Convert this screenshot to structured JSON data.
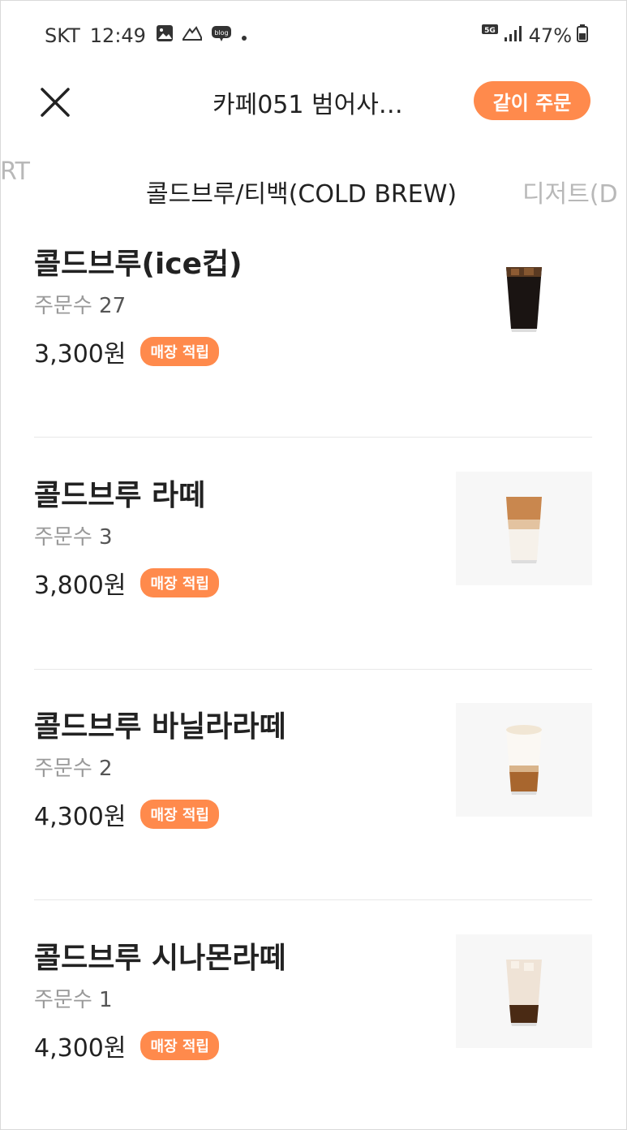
{
  "status_bar": {
    "carrier": "SKT",
    "time": "12:49",
    "battery": "47%"
  },
  "header": {
    "title": "카페051 범어사…",
    "group_order_label": "같이 주문"
  },
  "tabs": {
    "prev": "RT",
    "active": "콜드브루/티백(COLD BREW)",
    "next": "디저트(D"
  },
  "orders_label": "주문수",
  "items": [
    {
      "name": "콜드브루(ice컵)",
      "order_count": "27",
      "price": "3,300원",
      "badge": "매장 적립"
    },
    {
      "name": "콜드브루 라떼",
      "order_count": "3",
      "price": "3,800원",
      "badge": "매장 적립"
    },
    {
      "name": "콜드브루 바닐라라떼",
      "order_count": "2",
      "price": "4,300원",
      "badge": "매장 적립"
    },
    {
      "name": "콜드브루 시나몬라떼",
      "order_count": "1",
      "price": "4,300원",
      "badge": "매장 적립"
    }
  ],
  "colors": {
    "accent": "#ff8a4c",
    "text": "#222222",
    "muted": "#9a9a9a"
  }
}
